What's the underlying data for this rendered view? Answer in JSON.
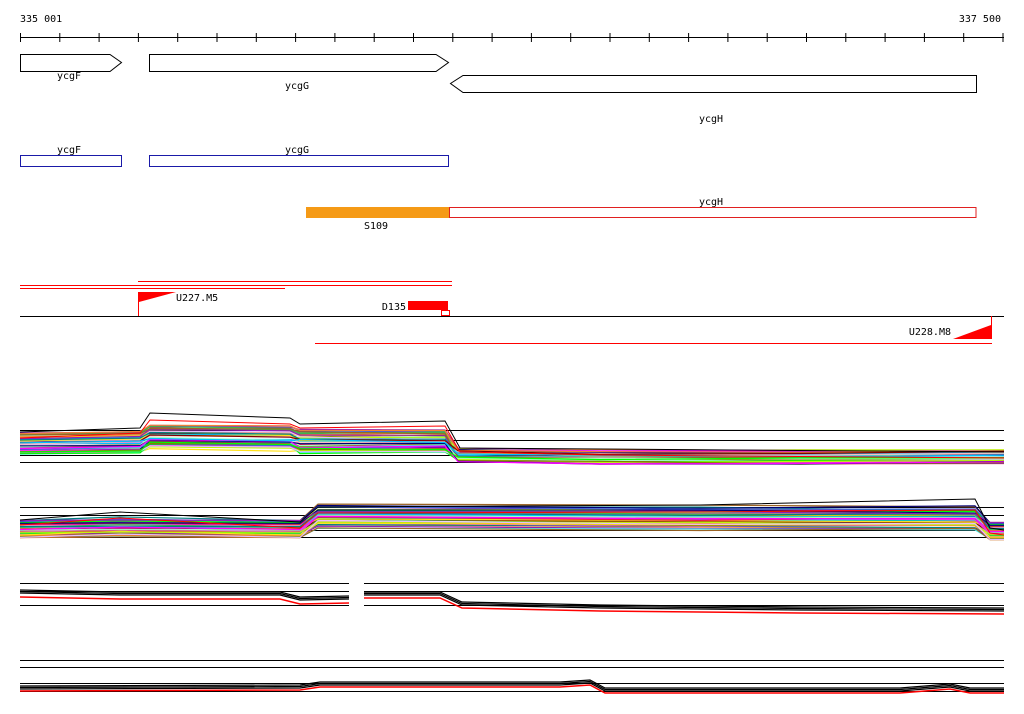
{
  "ruler": {
    "start_label": "335 001",
    "end_label": "337 500"
  },
  "annotation_track": {
    "genes": [
      {
        "name": "ycgF",
        "strand": "+"
      },
      {
        "name": "ycgG",
        "strand": "+"
      },
      {
        "name": "ycgH",
        "strand": "-"
      }
    ]
  },
  "cds_track": {
    "boxes": [
      {
        "name": "ycgF",
        "color": "#1a1aa8"
      },
      {
        "name": "ycgG",
        "color": "#1a1aa8"
      }
    ]
  },
  "region_track": {
    "segment_label": "S109",
    "segment_color": "#f59a16",
    "box_label": "ycgH",
    "box_color": "#e02020"
  },
  "feature_track": {
    "labels": [
      "U227.M5",
      "D135",
      "U228.M8"
    ],
    "color": "#ff0000"
  },
  "palette": [
    "#e6194b",
    "#3cb44b",
    "#ffe119",
    "#4363d8",
    "#f58231",
    "#911eb4",
    "#46f0f0",
    "#f032e6",
    "#bcf60c",
    "#fabebe",
    "#008080",
    "#e6beff",
    "#9a6324",
    "#800000",
    "#aaffc3",
    "#808000",
    "#000075",
    "#ff00ff",
    "#00ff00",
    "#00bfff"
  ]
}
